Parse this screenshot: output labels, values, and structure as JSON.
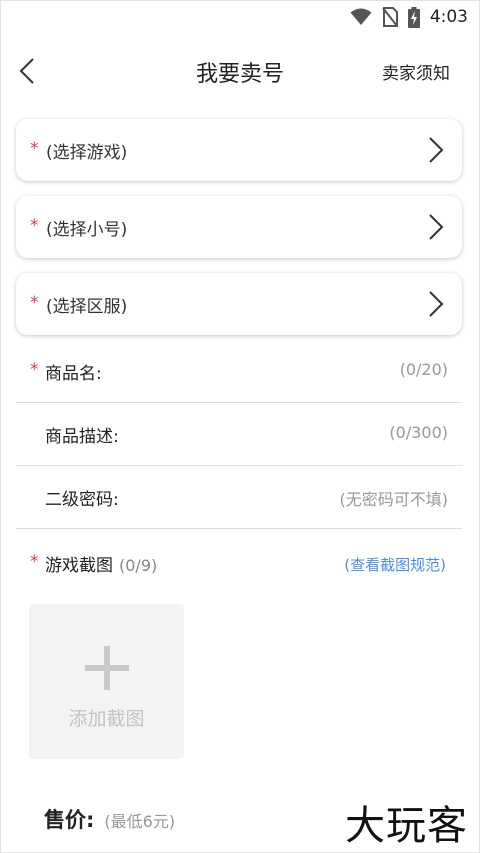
{
  "status_bar": {
    "time": "4:03",
    "icons": [
      "wifi-icon",
      "no-sim-icon",
      "battery-charging-icon"
    ]
  },
  "header": {
    "title": "我要卖号",
    "back_icon": "chevron-left-icon",
    "notice_label": "卖家须知"
  },
  "selectors": [
    {
      "required_mark": "*",
      "label": "(选择游戏)"
    },
    {
      "required_mark": "*",
      "label": "(选择小号)"
    },
    {
      "required_mark": "*",
      "label": "(选择区服)"
    }
  ],
  "fields": {
    "product_name": {
      "required_mark": "*",
      "label": "商品名:",
      "counter": "(0/20)"
    },
    "product_desc": {
      "label": "商品描述:",
      "counter": "(0/300)"
    },
    "secondary_password": {
      "label": "二级密码:",
      "placeholder": "(无密码可不填)"
    }
  },
  "screenshots": {
    "required_mark": "*",
    "label": "游戏截图",
    "count": "(0/9)",
    "rules_link": "(查看截图规范)",
    "add_label": "添加截图"
  },
  "price": {
    "label": "售价:",
    "hint": "(最低6元)"
  },
  "watermark": "大玩客",
  "colors": {
    "required": "#e8384f",
    "link": "#4a8fe7",
    "tile_bg": "#f3f3f3"
  }
}
